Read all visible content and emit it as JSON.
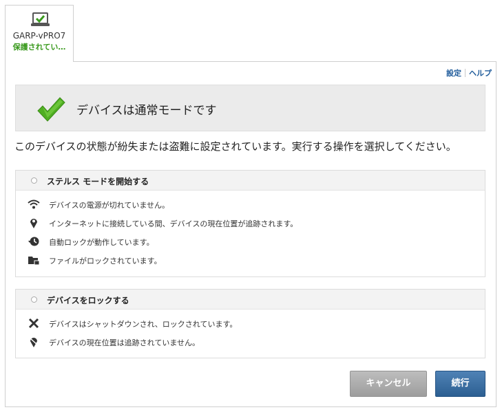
{
  "device": {
    "name": "GARP-vPRO7",
    "status": "保護されてい…",
    "status_color": "#3a9a1e"
  },
  "top_links": {
    "settings": "設定",
    "help": "ヘルプ"
  },
  "mode_banner": {
    "title": "デバイスは通常モードです",
    "icon": "green-checkmark-icon"
  },
  "instruction": "このデバイスの状態が紛失または盗難に設定されています。実行する操作を選択してください。",
  "options": [
    {
      "label": "ステルス モードを開始する",
      "selected": false,
      "features": [
        {
          "icon": "wifi-icon",
          "text": "デバイスの電源が切れていません。"
        },
        {
          "icon": "location-pin-icon",
          "text": "インターネットに接続している間、デバイスの現在位置が追跡されます。"
        },
        {
          "icon": "clock-history-icon",
          "text": "自動ロックが動作しています。"
        },
        {
          "icon": "folder-lock-icon",
          "text": "ファイルがロックされています。"
        }
      ]
    },
    {
      "label": "デバイスをロックする",
      "selected": false,
      "features": [
        {
          "icon": "close-x-icon",
          "text": "デバイスはシャットダウンされ、ロックされています。"
        },
        {
          "icon": "location-pin-off-icon",
          "text": "デバイスの現在位置は追跡されていません。"
        }
      ]
    }
  ],
  "buttons": {
    "cancel": "キャンセル",
    "continue": "続行"
  },
  "colors": {
    "accent_link": "#1d5a9a",
    "primary_button": "#2c5f92",
    "secondary_button": "#9d9d9d"
  }
}
